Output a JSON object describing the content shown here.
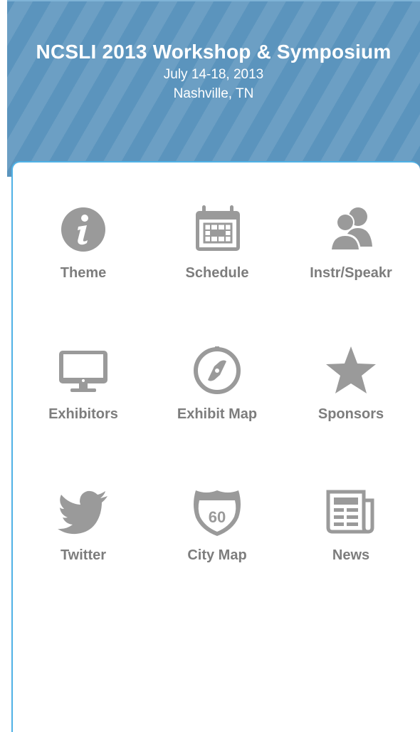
{
  "header": {
    "title": "NCSLI 2013 Workshop & Symposium",
    "dates": "July 14-18, 2013",
    "location": "Nashville, TN"
  },
  "menu": {
    "items": [
      {
        "label": "Theme",
        "icon": "info-icon"
      },
      {
        "label": "Schedule",
        "icon": "calendar-icon"
      },
      {
        "label": "Instr/Speakr",
        "icon": "people-icon"
      },
      {
        "label": "Exhibitors",
        "icon": "monitor-icon"
      },
      {
        "label": "Exhibit Map",
        "icon": "compass-icon"
      },
      {
        "label": "Sponsors",
        "icon": "star-icon"
      },
      {
        "label": "Twitter",
        "icon": "twitter-bird-icon"
      },
      {
        "label": "City Map",
        "icon": "highway-shield-icon",
        "icon_text": "60"
      },
      {
        "label": "News",
        "icon": "newspaper-icon"
      }
    ]
  },
  "colors": {
    "header_bg": "#5b94bd",
    "panel_border": "#4fb1e6",
    "icon_gray": "#9a9a9a",
    "label_gray": "#7d7d7d"
  }
}
